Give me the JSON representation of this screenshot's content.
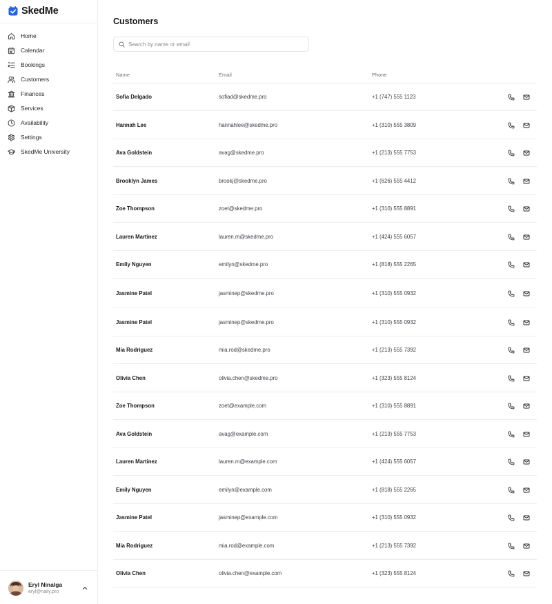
{
  "app": {
    "name": "SkedMe",
    "accent": "#2563eb"
  },
  "nav": [
    {
      "label": "Home",
      "icon": "home-icon"
    },
    {
      "label": "Calendar",
      "icon": "calendar-icon"
    },
    {
      "label": "Bookings",
      "icon": "list-ordered-icon"
    },
    {
      "label": "Customers",
      "icon": "users-icon"
    },
    {
      "label": "Finances",
      "icon": "bank-icon"
    },
    {
      "label": "Services",
      "icon": "box-icon"
    },
    {
      "label": "Availability",
      "icon": "clock-icon"
    },
    {
      "label": "Settings",
      "icon": "gear-icon"
    },
    {
      "label": "SkedMe University",
      "icon": "graduation-cap-icon"
    }
  ],
  "user": {
    "name": "Eryl Ninalga",
    "email": "eryl@naily.pro"
  },
  "page": {
    "title": "Customers",
    "search_placeholder": "Search by name or email"
  },
  "table": {
    "columns": [
      "Name",
      "Email",
      "Phone"
    ],
    "rows": [
      {
        "name": "Sofia Delgado",
        "email": "sofiad@skedme.pro",
        "phone": "+1 (747) 555 1123"
      },
      {
        "name": "Hannah Lee",
        "email": "hannahlee@skedme.pro",
        "phone": "+1 (310) 555 3809"
      },
      {
        "name": "Ava Goldstein",
        "email": "avag@skedme.pro",
        "phone": "+1 (213) 555 7753"
      },
      {
        "name": "Brooklyn James",
        "email": "brookj@skedme.pro",
        "phone": "+1 (626) 555 4412"
      },
      {
        "name": "Zoe Thompson",
        "email": "zoet@skedme.pro",
        "phone": "+1 (310) 555 8891"
      },
      {
        "name": "Lauren Martinez",
        "email": "lauren.m@skedme.pro",
        "phone": "+1 (424) 555 6057"
      },
      {
        "name": "Emily Nguyen",
        "email": "emilyn@skedme.pro",
        "phone": "+1 (818) 555 2265"
      },
      {
        "name": "Jasmine Patel",
        "email": "jasminep@skedme.pro",
        "phone": "+1 (310) 555 0932"
      },
      {
        "name": "Jasmine Patel",
        "email": "jasminep@skedme.pro",
        "phone": "+1 (310) 555 0932"
      },
      {
        "name": "Mia Rodriguez",
        "email": "mia.rod@skedme.pro",
        "phone": "+1 (213) 555 7392"
      },
      {
        "name": "Olivia Chen",
        "email": "olivia.chen@skedme.pro",
        "phone": "+1 (323) 555 8124"
      },
      {
        "name": "Zoe Thompson",
        "email": "zoet@example.com",
        "phone": "+1 (310) 555 8891"
      },
      {
        "name": "Ava Goldstein",
        "email": "avag@example.com",
        "phone": "+1 (213) 555 7753"
      },
      {
        "name": "Lauren Martinez",
        "email": "lauren.m@example.com",
        "phone": "+1 (424) 555 6057"
      },
      {
        "name": "Emily Nguyen",
        "email": "emilyn@example.com",
        "phone": "+1 (818) 555 2265"
      },
      {
        "name": "Jasmine Patel",
        "email": "jasminep@example.com",
        "phone": "+1 (310) 555 0932"
      },
      {
        "name": "Mia Rodriguez",
        "email": "mia.rod@example.com",
        "phone": "+1 (213) 555 7392"
      },
      {
        "name": "Olivia Chen",
        "email": "olivia.chen@example.com",
        "phone": "+1 (323) 555 8124"
      }
    ],
    "row_actions": [
      "phone-icon",
      "mail-icon"
    ]
  }
}
